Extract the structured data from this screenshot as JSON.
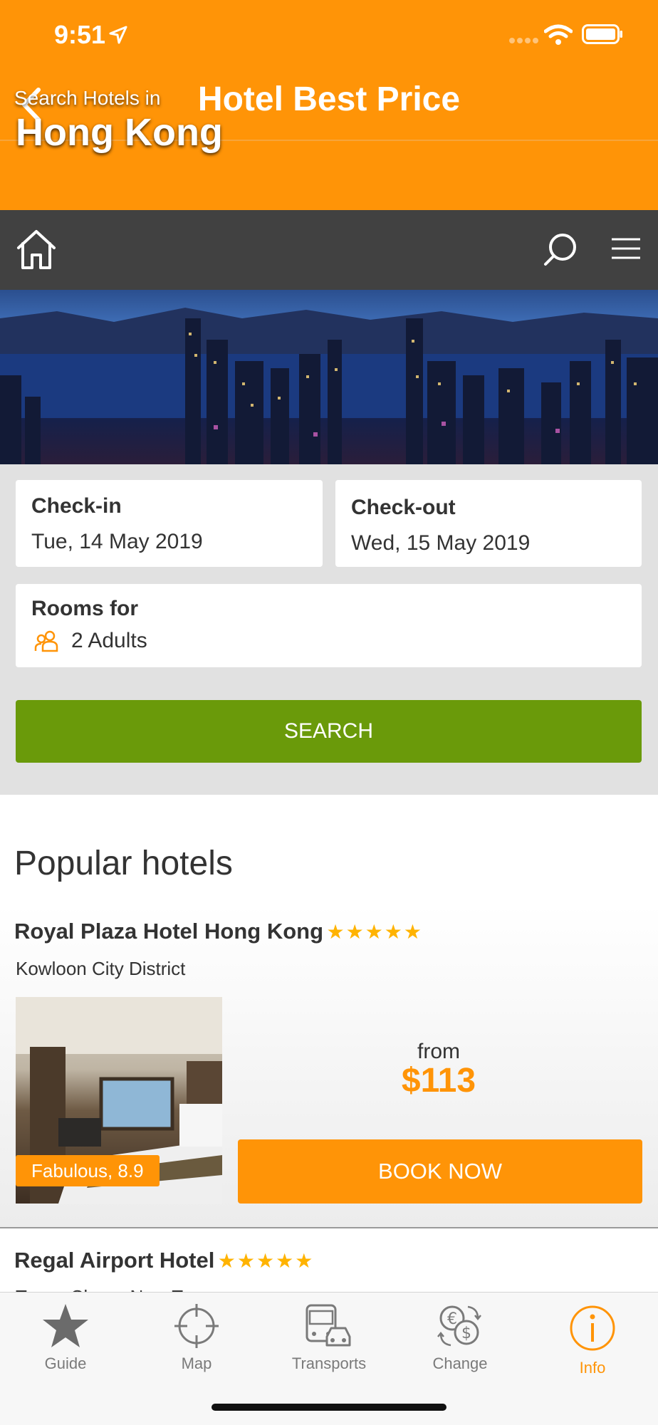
{
  "status": {
    "time": "9:51"
  },
  "nav": {
    "title": "Hotel Best Price"
  },
  "hero": {
    "subtitle": "Search Hotels in",
    "city": "Hong Kong"
  },
  "search": {
    "checkin_label": "Check-in",
    "checkin_value": "Tue, 14 May 2019",
    "checkout_label": "Check-out",
    "checkout_value": "Wed, 15 May 2019",
    "rooms_label": "Rooms for",
    "rooms_value": "2 Adults",
    "button_label": "SEARCH"
  },
  "popular": {
    "title": "Popular hotels",
    "hotels": [
      {
        "name": "Royal Plaza Hotel Hong Kong",
        "stars": "★★★★★",
        "district": "Kowloon City District",
        "rating": "Fabulous, 8.9",
        "from_label": "from",
        "price": "$113",
        "book_label": "BOOK NOW"
      },
      {
        "name": "Regal Airport Hotel",
        "stars": "★★★★★",
        "district": "Tsuen Chung New Town"
      }
    ]
  },
  "tabs": [
    {
      "label": "Guide",
      "icon": "star-icon"
    },
    {
      "label": "Map",
      "icon": "crosshair-icon"
    },
    {
      "label": "Transports",
      "icon": "bus-car-icon"
    },
    {
      "label": "Change",
      "icon": "currency-exchange-icon"
    },
    {
      "label": "Info",
      "icon": "info-icon"
    }
  ],
  "colors": {
    "accent": "#ff9407",
    "search_button": "#6a9a0a",
    "header_dark": "#414141",
    "star": "#ffb300"
  }
}
